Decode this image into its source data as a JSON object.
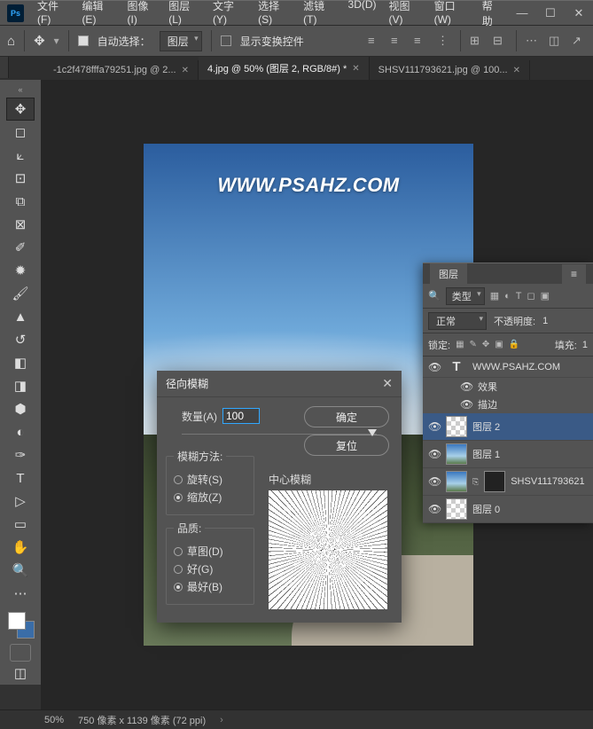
{
  "menu": {
    "file": "文件(F)",
    "edit": "编辑(E)",
    "image": "图像(I)",
    "layer": "图层(L)",
    "type": "文字(Y)",
    "select": "选择(S)",
    "filter": "滤镜(T)",
    "threed": "3D(D)",
    "view": "视图(V)",
    "window": "窗口(W)",
    "help": "帮助"
  },
  "optbar": {
    "autoselect_label": "自动选择：",
    "autoselect_dd": "图层",
    "transform_label": "显示变换控件"
  },
  "tabs": {
    "t1": "-1c2f478fffa79251.jpg @ 2...",
    "t2": "4.jpg @ 50% (图层 2, RGB/8#) *",
    "t3": "SHSV111793621.jpg @ 100..."
  },
  "canvas": {
    "watermark": "WWW.PSAHZ.COM"
  },
  "statusbar": {
    "zoom": "50%",
    "docinfo": "750 像素 x 1139 像素 (72 ppi)"
  },
  "dialog": {
    "title": "径向模糊",
    "amount_label": "数量(A)",
    "amount_value": "100",
    "ok": "确定",
    "reset": "复位",
    "method_legend": "模糊方法:",
    "method_spin": "旋转(S)",
    "method_zoom": "缩放(Z)",
    "quality_legend": "品质:",
    "quality_draft": "草图(D)",
    "quality_good": "好(G)",
    "quality_best": "最好(B)",
    "preview_label": "中心模糊"
  },
  "layers": {
    "tab": "图层",
    "filter_kind": "类型",
    "blend_mode": "正常",
    "opacity_label": "不透明度:",
    "opacity_val": "1",
    "lock_label": "锁定:",
    "fill_label": "填充:",
    "fill_val": "1",
    "text_layer": "WWW.PSAHZ.COM",
    "fx_label": "效果",
    "fx_stroke": "描边",
    "layer2": "图层 2",
    "layer1": "图层 1",
    "smart": "SHSV111793621",
    "layer0": "图层 0"
  }
}
